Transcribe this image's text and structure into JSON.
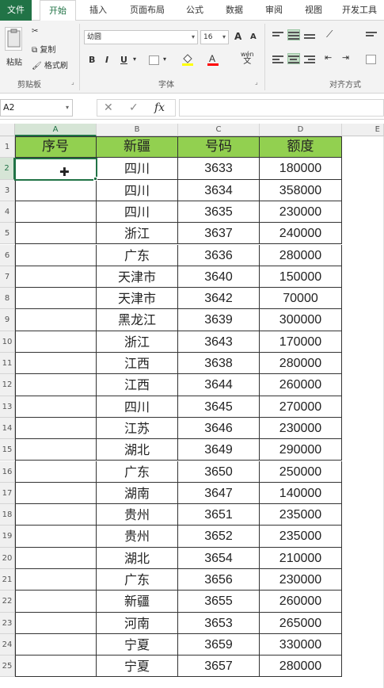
{
  "ribbon_tabs": [
    "文件",
    "开始",
    "插入",
    "页面布局",
    "公式",
    "数据",
    "审阅",
    "视图",
    "开发工具"
  ],
  "active_tab": "开始",
  "clipboard": {
    "paste_label": "粘贴",
    "cut_label": "剪切",
    "copy_label": "复制",
    "format_painter_label": "格式刷",
    "group_label": "剪贴板"
  },
  "font": {
    "name": "幼圆",
    "size": "16",
    "group_label": "字体",
    "bold": "B",
    "italic": "I",
    "underline": "U",
    "grow": "A",
    "shrink": "A",
    "wen": "wén",
    "wen_char": "文"
  },
  "alignment": {
    "group_label": "对齐方式"
  },
  "formula_bar": {
    "name_box": "A2",
    "fx": "fx",
    "formula": ""
  },
  "columns": [
    "A",
    "B",
    "C",
    "D",
    "E"
  ],
  "headers": [
    "序号",
    "新疆",
    "号码",
    "额度"
  ],
  "rows": [
    {
      "row": "2",
      "a": "",
      "b": "四川",
      "c": "3633",
      "d": "180000"
    },
    {
      "row": "3",
      "a": "",
      "b": "四川",
      "c": "3634",
      "d": "358000"
    },
    {
      "row": "4",
      "a": "",
      "b": "四川",
      "c": "3635",
      "d": "230000"
    },
    {
      "row": "5",
      "a": "",
      "b": "浙江",
      "c": "3637",
      "d": "240000"
    },
    {
      "row": "6",
      "a": "",
      "b": "广东",
      "c": "3636",
      "d": "280000"
    },
    {
      "row": "7",
      "a": "",
      "b": "天津市",
      "c": "3640",
      "d": "150000"
    },
    {
      "row": "8",
      "a": "",
      "b": "天津市",
      "c": "3642",
      "d": "70000"
    },
    {
      "row": "9",
      "a": "",
      "b": "黑龙江",
      "c": "3639",
      "d": "300000"
    },
    {
      "row": "10",
      "a": "",
      "b": "浙江",
      "c": "3643",
      "d": "170000"
    },
    {
      "row": "11",
      "a": "",
      "b": "江西",
      "c": "3638",
      "d": "280000"
    },
    {
      "row": "12",
      "a": "",
      "b": "江西",
      "c": "3644",
      "d": "260000"
    },
    {
      "row": "13",
      "a": "",
      "b": "四川",
      "c": "3645",
      "d": "270000"
    },
    {
      "row": "14",
      "a": "",
      "b": "江苏",
      "c": "3646",
      "d": "230000"
    },
    {
      "row": "15",
      "a": "",
      "b": "湖北",
      "c": "3649",
      "d": "290000"
    },
    {
      "row": "16",
      "a": "",
      "b": "广东",
      "c": "3650",
      "d": "250000"
    },
    {
      "row": "17",
      "a": "",
      "b": "湖南",
      "c": "3647",
      "d": "140000"
    },
    {
      "row": "18",
      "a": "",
      "b": "贵州",
      "c": "3651",
      "d": "235000"
    },
    {
      "row": "19",
      "a": "",
      "b": "贵州",
      "c": "3652",
      "d": "235000"
    },
    {
      "row": "20",
      "a": "",
      "b": "湖北",
      "c": "3654",
      "d": "210000"
    },
    {
      "row": "21",
      "a": "",
      "b": "广东",
      "c": "3656",
      "d": "230000"
    },
    {
      "row": "22",
      "a": "",
      "b": "新疆",
      "c": "3655",
      "d": "260000"
    },
    {
      "row": "23",
      "a": "",
      "b": "河南",
      "c": "3653",
      "d": "265000"
    },
    {
      "row": "24",
      "a": "",
      "b": "宁夏",
      "c": "3659",
      "d": "330000"
    },
    {
      "row": "25",
      "a": "",
      "b": "宁夏",
      "c": "3657",
      "d": "280000"
    }
  ],
  "header_row_number": "1",
  "selection": {
    "cell": "A2"
  },
  "colors": {
    "header_fill": "#92d050",
    "accent": "#217346"
  }
}
